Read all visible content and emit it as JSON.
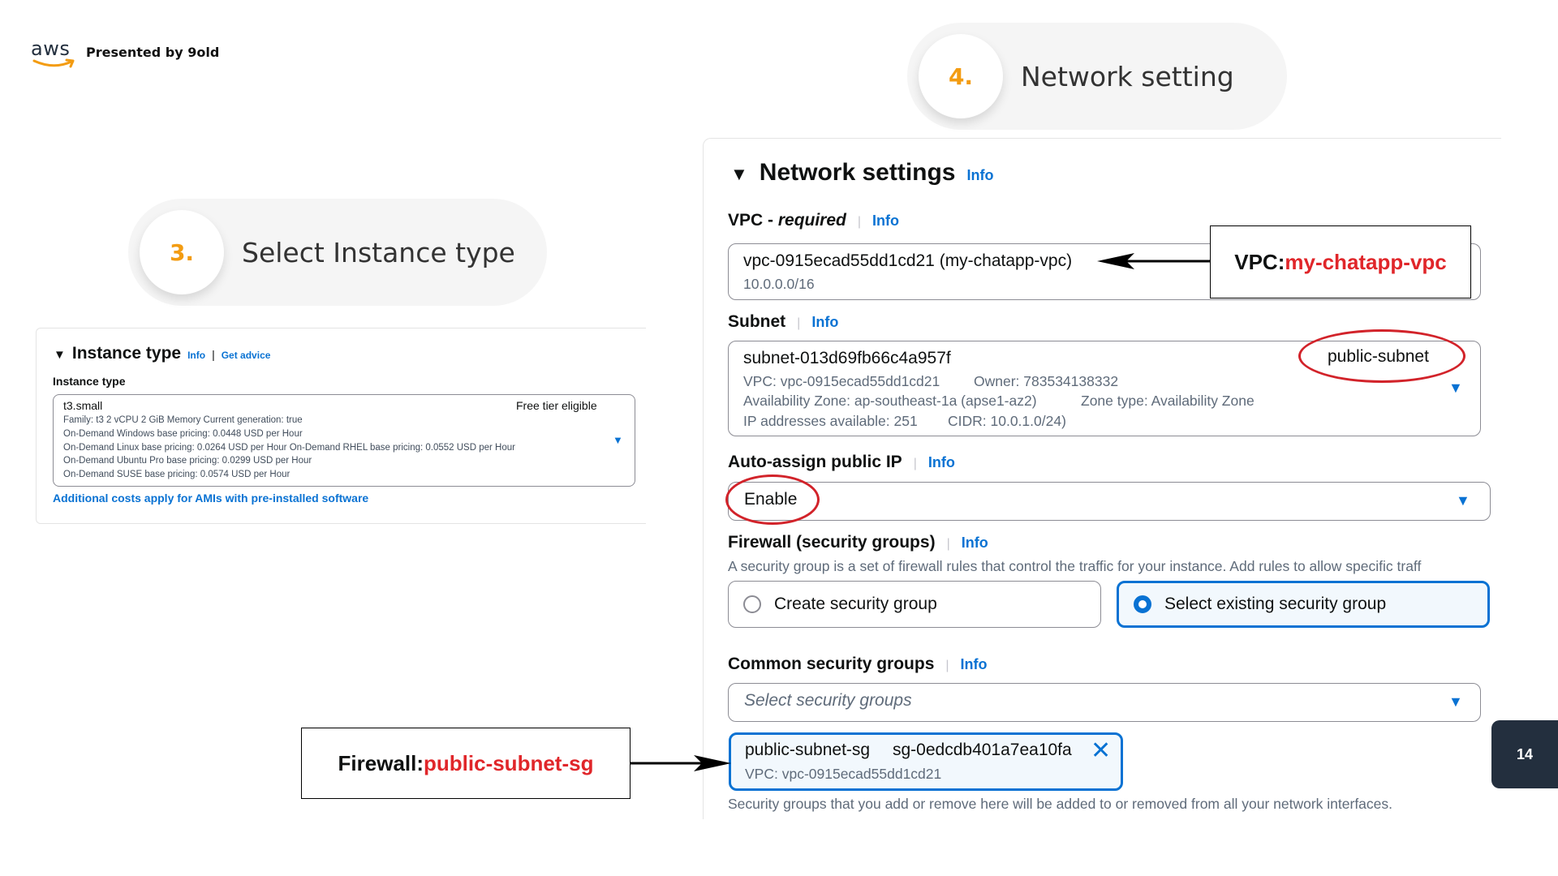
{
  "branding": {
    "logo_text": "aws",
    "presented_by": "Presented by 9old"
  },
  "steps": [
    {
      "number": "3.",
      "label": "Select Instance type"
    },
    {
      "number": "4.",
      "label": "Network setting"
    }
  ],
  "instance_panel": {
    "title": "Instance type",
    "info_link": "Info",
    "separator": "|",
    "advice_link": "Get advice",
    "field_label": "Instance type",
    "selected_type": "t3.small",
    "free_tier": "Free tier eligible",
    "details": [
      "Family: t3     2 vCPU     2 GiB Memory     Current generation: true",
      "On-Demand Windows base pricing: 0.0448 USD per Hour",
      "On-Demand Linux base pricing: 0.0264 USD per Hour     On-Demand RHEL base pricing: 0.0552 USD per Hour",
      "On-Demand Ubuntu Pro base pricing: 0.0299 USD per Hour",
      "On-Demand SUSE base pricing: 0.0574 USD per Hour"
    ],
    "additional_costs_link": "Additional costs apply for AMIs with pre-installed software"
  },
  "network_panel": {
    "title": "Network settings",
    "info": "Info",
    "vpc": {
      "label_prefix": "VPC - ",
      "label_required": "required",
      "value": "vpc-0915ecad55dd1cd21 (my-chatapp-vpc)",
      "cidr": "10.0.0.0/16"
    },
    "subnet": {
      "label": "Subnet",
      "value": "subnet-013d69fb66c4a957f",
      "name": "public-subnet",
      "vpc_line": "VPC: vpc-0915ecad55dd1cd21",
      "owner_line": "Owner: 783534138332",
      "az_line": "Availability Zone: ap-southeast-1a (apse1-az2)",
      "zone_type_line": "Zone type: Availability Zone",
      "ip_line": "IP addresses available: 251",
      "cidr_line": "CIDR: 10.0.1.0/24)"
    },
    "auto_assign": {
      "label": "Auto-assign public IP",
      "value": "Enable"
    },
    "firewall": {
      "label": "Firewall (security groups)",
      "description": "A security group is a set of firewall rules that control the traffic for your instance. Add rules to allow specific traff",
      "option_create": "Create security group",
      "option_existing": "Select existing security group"
    },
    "common_sg": {
      "label": "Common security groups",
      "placeholder": "Select security groups",
      "chip_name": "public-subnet-sg",
      "chip_id": "sg-0edcdb401a7ea10fa",
      "chip_vpc": "VPC: vpc-0915ecad55dd1cd21",
      "footer_note": "Security groups that you add or remove here will be added to or removed from all your network interfaces."
    }
  },
  "callouts": {
    "vpc_prefix": "VPC: ",
    "vpc_value": "my-chatapp-vpc",
    "firewall_prefix": "Firewall: ",
    "firewall_value": "public-subnet-sg"
  },
  "slide": {
    "page_number": "14"
  },
  "colors": {
    "accent_blue": "#0972d3",
    "step_orange": "#f39c12",
    "highlight_red": "#d2232a",
    "aws_dark": "#232f3e"
  }
}
